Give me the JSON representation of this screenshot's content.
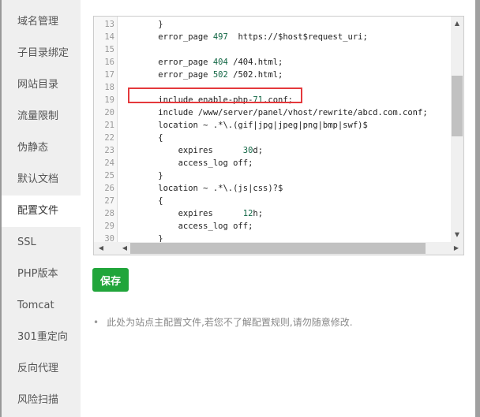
{
  "sidebar": {
    "items": [
      {
        "label": "域名管理"
      },
      {
        "label": "子目录绑定"
      },
      {
        "label": "网站目录"
      },
      {
        "label": "流量限制"
      },
      {
        "label": "伪静态"
      },
      {
        "label": "默认文档"
      },
      {
        "label": "配置文件",
        "active": true
      },
      {
        "label": "SSL"
      },
      {
        "label": "PHP版本"
      },
      {
        "label": "Tomcat"
      },
      {
        "label": "301重定向"
      },
      {
        "label": "反向代理"
      },
      {
        "label": "风险扫描"
      }
    ]
  },
  "editor": {
    "lines": [
      {
        "n": "13",
        "code": "    }"
      },
      {
        "n": "14",
        "code": "    error_page 497  https://$host$request_uri;"
      },
      {
        "n": "15",
        "code": ""
      },
      {
        "n": "16",
        "code": "    error_page 404 /404.html;"
      },
      {
        "n": "17",
        "code": "    error_page 502 /502.html;"
      },
      {
        "n": "18",
        "code": ""
      },
      {
        "n": "19",
        "code": "    include enable-php-71.conf;"
      },
      {
        "n": "20",
        "code": "    include /www/server/panel/vhost/rewrite/abcd.com.conf;"
      },
      {
        "n": "21",
        "code": "    location ~ .*\\.(gif|jpg|jpeg|png|bmp|swf)$"
      },
      {
        "n": "22",
        "code": "    {"
      },
      {
        "n": "23",
        "code": "        expires      30d;"
      },
      {
        "n": "24",
        "code": "        access_log off;"
      },
      {
        "n": "25",
        "code": "    }"
      },
      {
        "n": "26",
        "code": "    location ~ .*\\.(js|css)?$"
      },
      {
        "n": "27",
        "code": "    {"
      },
      {
        "n": "28",
        "code": "        expires      12h;"
      },
      {
        "n": "29",
        "code": "        access_log off;"
      },
      {
        "n": "30",
        "code": "    }"
      }
    ],
    "highlighted_line": "19"
  },
  "save_label": "保存",
  "tip": "此处为站点主配置文件,若您不了解配置规则,请勿随意修改.",
  "colors": {
    "accent": "#20a53a",
    "highlight_box": "#e4393c",
    "number": "#116644"
  }
}
